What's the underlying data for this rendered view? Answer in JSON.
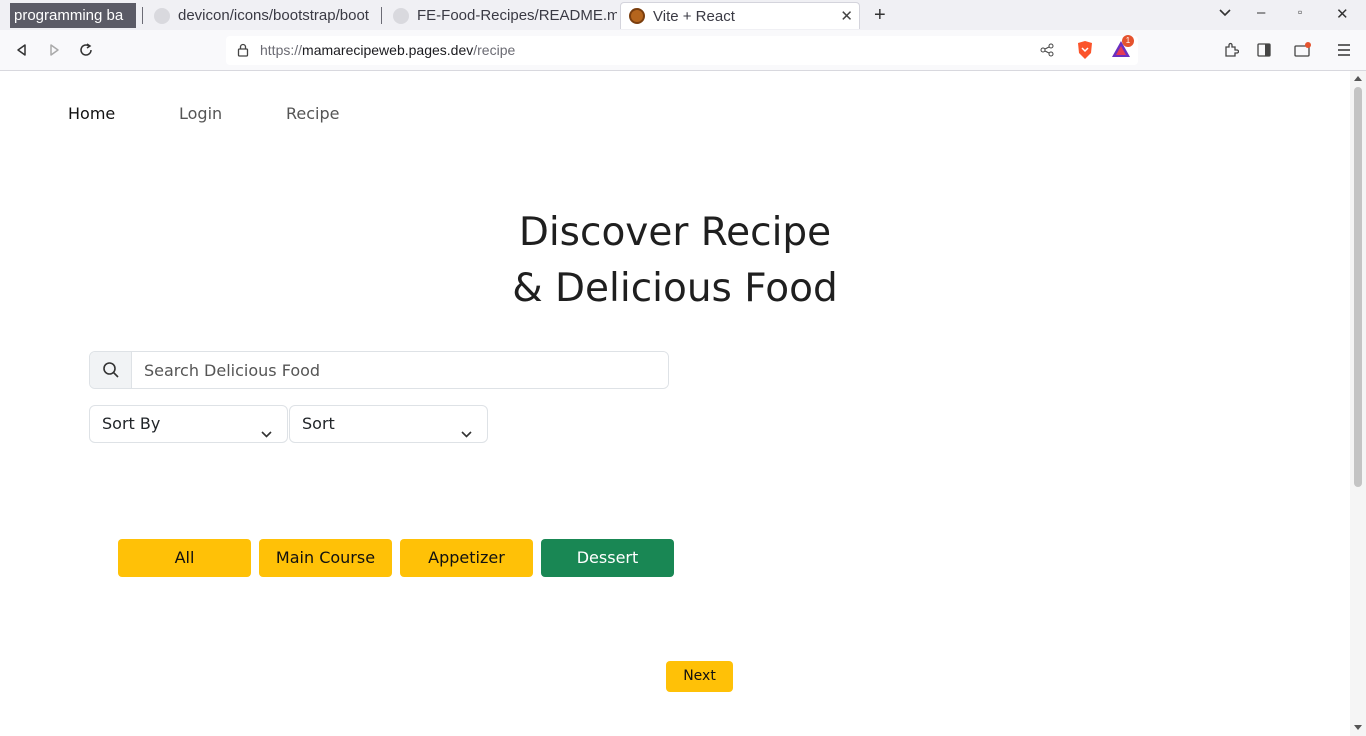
{
  "browser": {
    "tab_group_label": "programming ba",
    "tabs": [
      {
        "title": "devicon/icons/bootstrap/boot"
      },
      {
        "title": "FE-Food-Recipes/README.m"
      },
      {
        "title": "Vite + React"
      }
    ],
    "url_prefix": "https://",
    "url_domain": "mamarecipeweb.pages.dev",
    "url_path": "/recipe",
    "brave_badge_count": "1"
  },
  "nav": {
    "home": "Home",
    "login": "Login",
    "recipe": "Recipe"
  },
  "hero": {
    "line1": "Discover Recipe",
    "line2": "& Delicious Food"
  },
  "search": {
    "placeholder": "Search Delicious Food"
  },
  "filters": {
    "sort_by": "Sort By",
    "sort": "Sort"
  },
  "categories": {
    "all": "All",
    "main_course": "Main Course",
    "appetizer": "Appetizer",
    "dessert": "Dessert"
  },
  "pagination": {
    "next": "Next"
  },
  "colors": {
    "category_default": "#ffc107",
    "category_active": "#198754"
  }
}
